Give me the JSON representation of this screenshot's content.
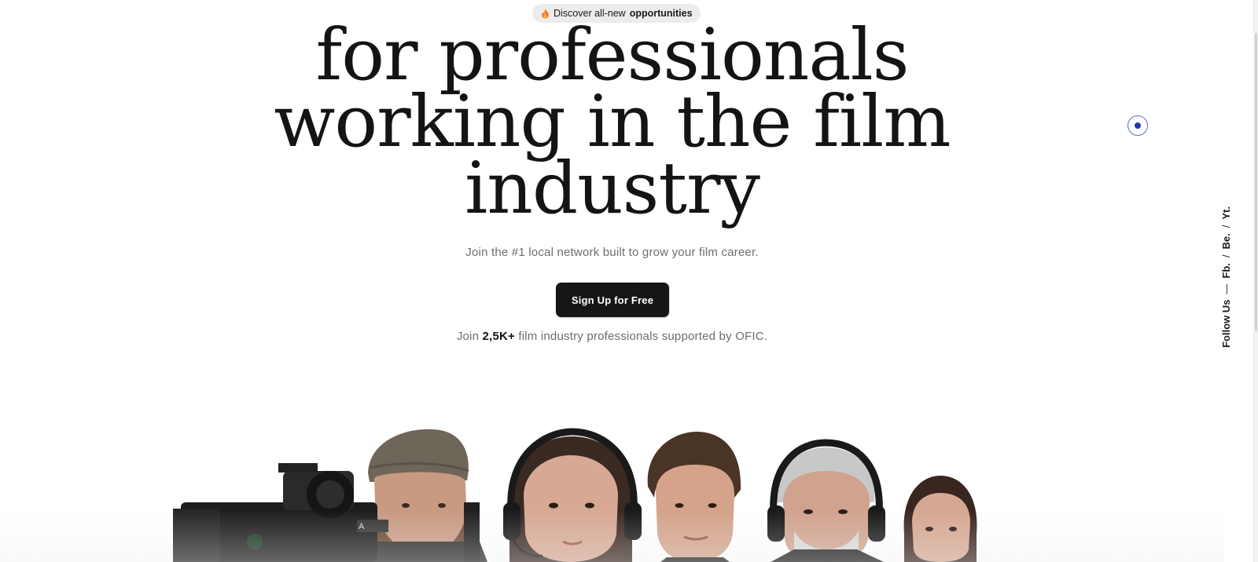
{
  "pill": {
    "icon": "flame-icon",
    "text": "Discover all-new",
    "strong": "opportunities"
  },
  "hero": {
    "headline_line1": "for professionals",
    "headline_line2": "working in the film",
    "headline_line3": "industry",
    "subtitle": "Join the #1 local network built to grow your film career.",
    "cta_label": "Sign Up for Free",
    "proof_prefix": "Join",
    "proof_count": "2,5K+",
    "proof_suffix": "film industry professionals supported by OFIC."
  },
  "social": {
    "label": "Follow Us",
    "dash": "—",
    "links": [
      "Fb.",
      "Be.",
      "Yt."
    ],
    "separator": "/"
  },
  "colors": {
    "text": "#141414",
    "muted": "#6d6d6d",
    "button_bg": "#161616",
    "pill_bg": "#ececec",
    "cursor_accent": "#1f35b8"
  },
  "crew": {
    "icons": [
      "camera-icon",
      "headset-icon"
    ]
  }
}
